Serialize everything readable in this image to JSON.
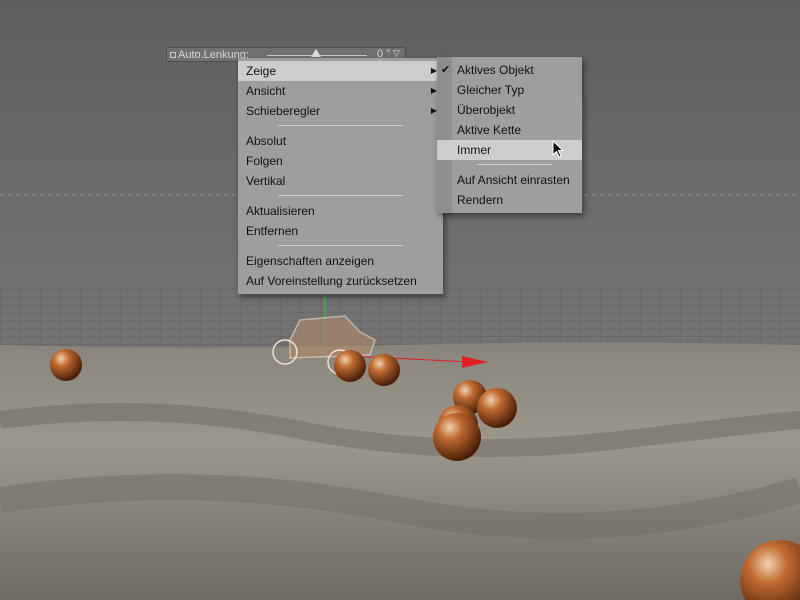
{
  "hud": {
    "label": "Auto.Lenkung:",
    "value": "0 °",
    "dropdown": "▽"
  },
  "main_menu": {
    "items": [
      {
        "label": "Zeige",
        "submenu": true,
        "highlighted": true
      },
      {
        "label": "Ansicht",
        "submenu": true
      },
      {
        "label": "Schieberegler",
        "submenu": true
      },
      {
        "label": "Absolut"
      },
      {
        "label": "Folgen"
      },
      {
        "label": "Vertikal"
      },
      {
        "label": "Aktualisieren"
      },
      {
        "label": "Entfernen"
      },
      {
        "label": "Eigenschaften anzeigen"
      },
      {
        "label": "Auf Voreinstellung zurücksetzen"
      }
    ]
  },
  "sub_menu": {
    "items": [
      {
        "label": "Aktives Objekt",
        "checked": true
      },
      {
        "label": "Gleicher Typ"
      },
      {
        "label": "Überobjekt"
      },
      {
        "label": "Aktive Kette"
      },
      {
        "label": "Immer",
        "highlighted": true
      },
      {
        "label": "Auf Ansicht einrasten"
      },
      {
        "label": "Rendern"
      }
    ]
  },
  "icons": {
    "arrow": "▶",
    "check": "✔"
  }
}
